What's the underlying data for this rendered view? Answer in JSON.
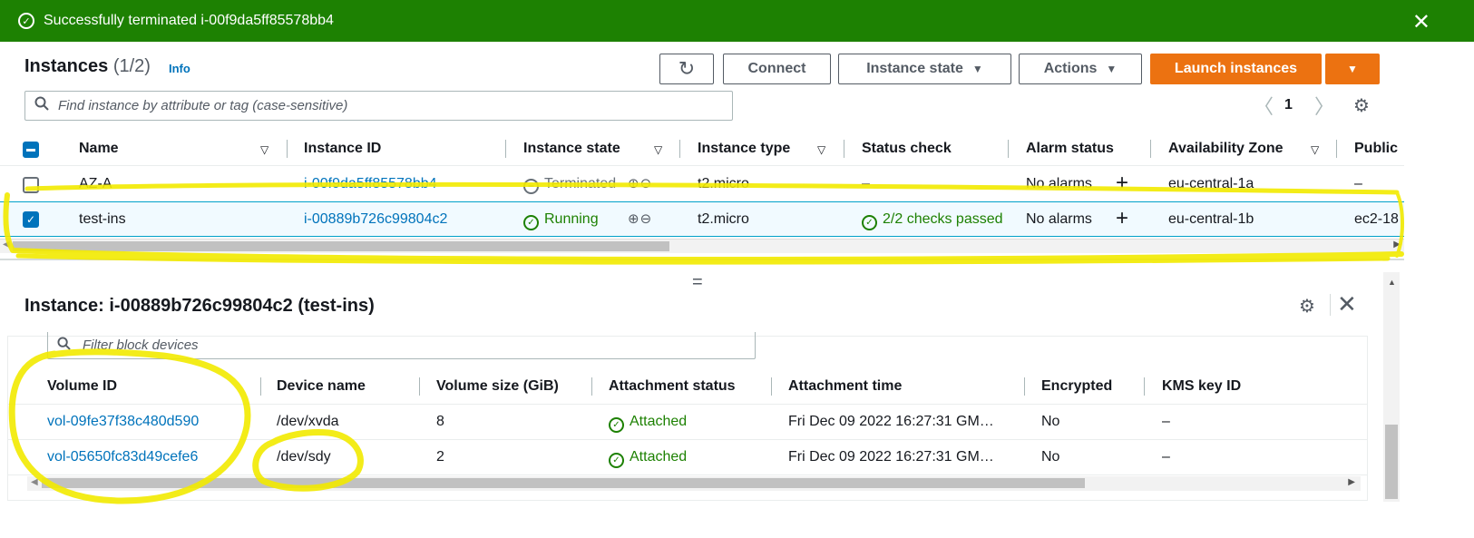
{
  "flash": {
    "message": "Successfully terminated i-00f9da5ff85578bb4",
    "close": "✕"
  },
  "header": {
    "title": "Instances",
    "count": "(1/2)",
    "info": "Info",
    "refresh_icon": "↻",
    "connect": "Connect",
    "instance_state": "Instance state",
    "actions": "Actions",
    "launch": "Launch instances",
    "caret": "▼"
  },
  "search": {
    "placeholder": "Find instance by attribute or tag (case-sensitive)",
    "icon": "search-icon"
  },
  "pagination": {
    "prev": "〈",
    "page": "1",
    "next": "〉",
    "settings_icon": "⚙"
  },
  "instances_table": {
    "columns": [
      "Name",
      "Instance ID",
      "Instance state",
      "Instance type",
      "Status check",
      "Alarm status",
      "Availability Zone",
      "Public"
    ],
    "rows": [
      {
        "selected": false,
        "name": "AZ-A",
        "instance_id": "i-00f9da5ff85578bb4",
        "state": "Terminated",
        "type": "t2.micro",
        "status_check": "–",
        "alarm": "No alarms",
        "az": "eu-central-1a",
        "public": "–"
      },
      {
        "selected": true,
        "name": "test-ins",
        "instance_id": "i-00889b726c99804c2",
        "state": "Running",
        "type": "t2.micro",
        "status_check": "2/2 checks passed",
        "alarm": "No alarms",
        "az": "eu-central-1b",
        "public": "ec2-18"
      }
    ]
  },
  "panel": {
    "drag_handle": "=",
    "title": "Instance: i-00889b726c99804c2 (test-ins)",
    "settings_icon": "⚙",
    "close": "✕",
    "filter_placeholder": "Filter block devices",
    "columns": [
      "Volume ID",
      "Device name",
      "Volume size (GiB)",
      "Attachment status",
      "Attachment time",
      "Encrypted",
      "KMS key ID"
    ],
    "rows": [
      {
        "volume_id": "vol-09fe37f38c480d590",
        "device": "/dev/xvda",
        "size": "8",
        "status": "Attached",
        "time": "Fri Dec 09 2022 16:27:31 GM…",
        "encrypted": "No",
        "kms": "–"
      },
      {
        "volume_id": "vol-05650fc83d49cefe6",
        "device": "/dev/sdy",
        "size": "2",
        "status": "Attached",
        "time": "Fri Dec 09 2022 16:27:31 GM…",
        "encrypted": "No",
        "kms": "–"
      }
    ]
  },
  "colors": {
    "flash_bg": "#1d8102",
    "link": "#0073bb",
    "primary": "#ec7211",
    "highlighter": "#f2ea00"
  }
}
